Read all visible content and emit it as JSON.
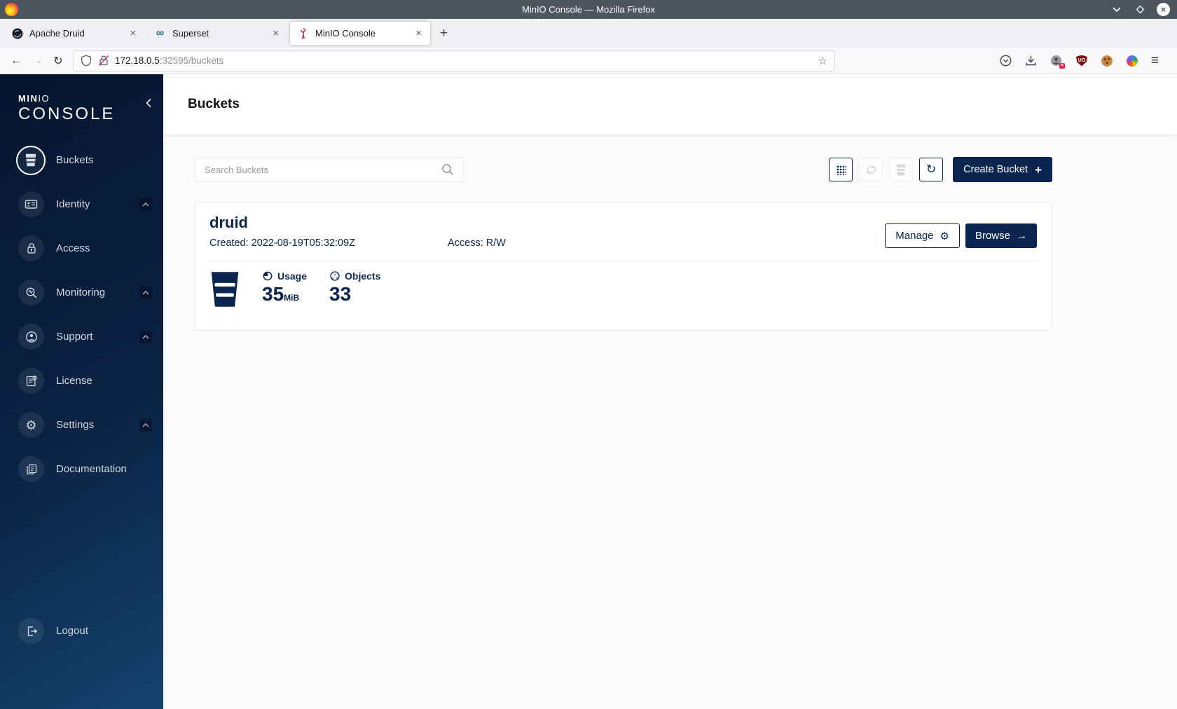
{
  "titlebar": {
    "title": "MinIO Console — Mozilla Firefox"
  },
  "tabs": [
    {
      "label": "Apache Druid"
    },
    {
      "label": "Superset"
    },
    {
      "label": "MinIO Console"
    }
  ],
  "urlbar": {
    "host": "172.18.0.5",
    "path": ":32595/buckets"
  },
  "glyphs": {
    "close": "×",
    "new_tab": "+",
    "back": "←",
    "forward": "→",
    "reload": "↻",
    "star": "☆",
    "menu": "≡",
    "refresh": "↻",
    "gear": "⚙",
    "arrow_right": "→",
    "plus": "+",
    "superset_infinity": "∞",
    "ublock_text": "UO",
    "badge_x": "×"
  },
  "sidebar": {
    "brand_bold": "MIN",
    "brand_light": "IO",
    "brand_console": "CONSOLE",
    "items": [
      {
        "label": "Buckets"
      },
      {
        "label": "Identity"
      },
      {
        "label": "Access"
      },
      {
        "label": "Monitoring"
      },
      {
        "label": "Support"
      },
      {
        "label": "License"
      },
      {
        "label": "Settings"
      },
      {
        "label": "Documentation"
      }
    ],
    "logout": "Logout"
  },
  "page": {
    "title": "Buckets",
    "search_placeholder": "Search Buckets",
    "create_button_label": "Create Bucket",
    "buckets": [
      {
        "name": "druid",
        "created": "Created: 2022-08-19T05:32:09Z",
        "access": "Access: R/W",
        "manage_label": "Manage",
        "browse_label": "Browse",
        "usage_label": "Usage",
        "usage_value": "35",
        "usage_unit": "MiB",
        "objects_label": "Objects",
        "objects_value": "33"
      }
    ]
  }
}
